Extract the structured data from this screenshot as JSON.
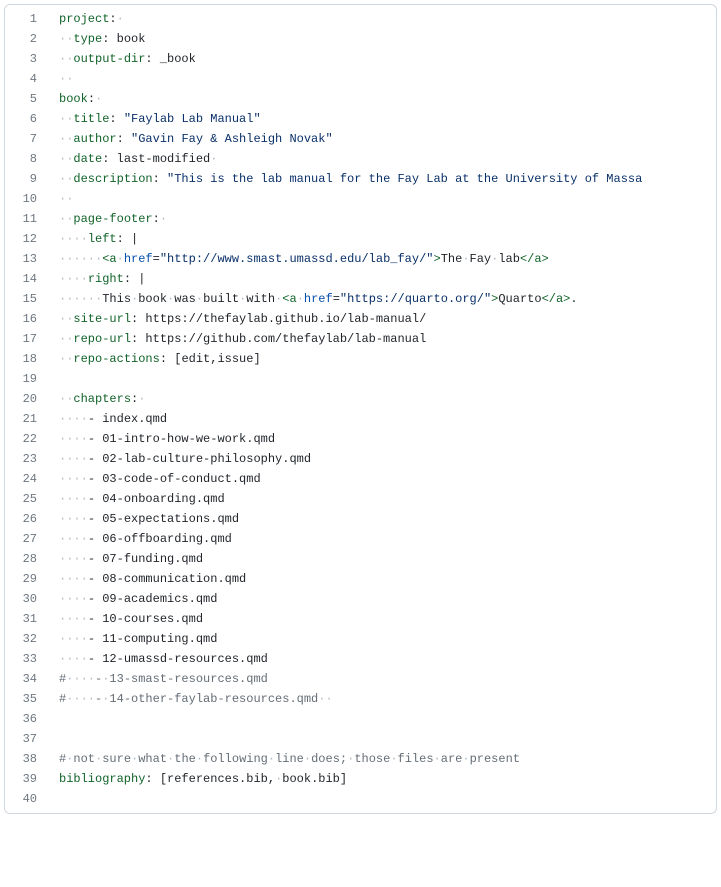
{
  "lines": [
    {
      "n": "1",
      "tokens": [
        {
          "c": "key",
          "t": "project"
        },
        {
          "c": "plain",
          "t": ":"
        },
        {
          "c": "ws",
          "t": "·"
        }
      ]
    },
    {
      "n": "2",
      "tokens": [
        {
          "c": "ws",
          "t": "··"
        },
        {
          "c": "key",
          "t": "type"
        },
        {
          "c": "plain",
          "t": ": "
        },
        {
          "c": "plain",
          "t": "book"
        }
      ]
    },
    {
      "n": "3",
      "tokens": [
        {
          "c": "ws",
          "t": "··"
        },
        {
          "c": "key",
          "t": "output-dir"
        },
        {
          "c": "plain",
          "t": ": "
        },
        {
          "c": "plain",
          "t": "_book"
        }
      ]
    },
    {
      "n": "4",
      "tokens": [
        {
          "c": "ws",
          "t": "··"
        }
      ]
    },
    {
      "n": "5",
      "tokens": [
        {
          "c": "key",
          "t": "book"
        },
        {
          "c": "plain",
          "t": ":"
        },
        {
          "c": "ws",
          "t": "·"
        }
      ]
    },
    {
      "n": "6",
      "tokens": [
        {
          "c": "ws",
          "t": "··"
        },
        {
          "c": "key",
          "t": "title"
        },
        {
          "c": "plain",
          "t": ": "
        },
        {
          "c": "str",
          "t": "\"Faylab Lab Manual\""
        }
      ]
    },
    {
      "n": "7",
      "tokens": [
        {
          "c": "ws",
          "t": "··"
        },
        {
          "c": "key",
          "t": "author"
        },
        {
          "c": "plain",
          "t": ": "
        },
        {
          "c": "str",
          "t": "\"Gavin Fay & Ashleigh Novak\""
        }
      ]
    },
    {
      "n": "8",
      "tokens": [
        {
          "c": "ws",
          "t": "··"
        },
        {
          "c": "key",
          "t": "date"
        },
        {
          "c": "plain",
          "t": ": "
        },
        {
          "c": "plain",
          "t": "last-modified"
        },
        {
          "c": "ws",
          "t": "·"
        }
      ]
    },
    {
      "n": "9",
      "tokens": [
        {
          "c": "ws",
          "t": "··"
        },
        {
          "c": "key",
          "t": "description"
        },
        {
          "c": "plain",
          "t": ": "
        },
        {
          "c": "str",
          "t": "\"This is the lab manual for the Fay Lab at the University of Massa"
        }
      ]
    },
    {
      "n": "10",
      "tokens": [
        {
          "c": "ws",
          "t": "··"
        }
      ]
    },
    {
      "n": "11",
      "tokens": [
        {
          "c": "ws",
          "t": "··"
        },
        {
          "c": "key",
          "t": "page-footer"
        },
        {
          "c": "plain",
          "t": ":"
        },
        {
          "c": "ws",
          "t": "·"
        }
      ]
    },
    {
      "n": "12",
      "tokens": [
        {
          "c": "ws",
          "t": "····"
        },
        {
          "c": "key",
          "t": "left"
        },
        {
          "c": "plain",
          "t": ": "
        },
        {
          "c": "plain",
          "t": "|"
        }
      ]
    },
    {
      "n": "13",
      "tokens": [
        {
          "c": "ws",
          "t": "······"
        },
        {
          "c": "tag",
          "t": "<a"
        },
        {
          "c": "ws",
          "t": "·"
        },
        {
          "c": "attr",
          "t": "href"
        },
        {
          "c": "plain",
          "t": "="
        },
        {
          "c": "str",
          "t": "\"http://www.smast.umassd.edu/lab_fay/\""
        },
        {
          "c": "tag",
          "t": ">"
        },
        {
          "c": "plain",
          "t": "The"
        },
        {
          "c": "ws",
          "t": "·"
        },
        {
          "c": "plain",
          "t": "Fay"
        },
        {
          "c": "ws",
          "t": "·"
        },
        {
          "c": "plain",
          "t": "lab"
        },
        {
          "c": "tag",
          "t": "</a>"
        }
      ]
    },
    {
      "n": "14",
      "tokens": [
        {
          "c": "ws",
          "t": "····"
        },
        {
          "c": "key",
          "t": "right"
        },
        {
          "c": "plain",
          "t": ": "
        },
        {
          "c": "plain",
          "t": "|"
        }
      ]
    },
    {
      "n": "15",
      "tokens": [
        {
          "c": "ws",
          "t": "······"
        },
        {
          "c": "plain",
          "t": "This"
        },
        {
          "c": "ws",
          "t": "·"
        },
        {
          "c": "plain",
          "t": "book"
        },
        {
          "c": "ws",
          "t": "·"
        },
        {
          "c": "plain",
          "t": "was"
        },
        {
          "c": "ws",
          "t": "·"
        },
        {
          "c": "plain",
          "t": "built"
        },
        {
          "c": "ws",
          "t": "·"
        },
        {
          "c": "plain",
          "t": "with"
        },
        {
          "c": "ws",
          "t": "·"
        },
        {
          "c": "tag",
          "t": "<a"
        },
        {
          "c": "ws",
          "t": "·"
        },
        {
          "c": "attr",
          "t": "href"
        },
        {
          "c": "plain",
          "t": "="
        },
        {
          "c": "str",
          "t": "\"https://quarto.org/\""
        },
        {
          "c": "tag",
          "t": ">"
        },
        {
          "c": "plain",
          "t": "Quarto"
        },
        {
          "c": "tag",
          "t": "</a>"
        },
        {
          "c": "plain",
          "t": "."
        }
      ]
    },
    {
      "n": "16",
      "tokens": [
        {
          "c": "ws",
          "t": "··"
        },
        {
          "c": "key",
          "t": "site-url"
        },
        {
          "c": "plain",
          "t": ": "
        },
        {
          "c": "plain",
          "t": "https://thefaylab.github.io/lab-manual/"
        }
      ]
    },
    {
      "n": "17",
      "tokens": [
        {
          "c": "ws",
          "t": "··"
        },
        {
          "c": "key",
          "t": "repo-url"
        },
        {
          "c": "plain",
          "t": ": "
        },
        {
          "c": "plain",
          "t": "https://github.com/thefaylab/lab-manual"
        }
      ]
    },
    {
      "n": "18",
      "tokens": [
        {
          "c": "ws",
          "t": "··"
        },
        {
          "c": "key",
          "t": "repo-actions"
        },
        {
          "c": "plain",
          "t": ": ["
        },
        {
          "c": "plain",
          "t": "edit"
        },
        {
          "c": "plain",
          "t": ","
        },
        {
          "c": "plain",
          "t": "issue"
        },
        {
          "c": "plain",
          "t": "]"
        }
      ]
    },
    {
      "n": "19",
      "tokens": []
    },
    {
      "n": "20",
      "tokens": [
        {
          "c": "ws",
          "t": "··"
        },
        {
          "c": "key",
          "t": "chapters"
        },
        {
          "c": "plain",
          "t": ":"
        },
        {
          "c": "ws",
          "t": "·"
        }
      ]
    },
    {
      "n": "21",
      "tokens": [
        {
          "c": "ws",
          "t": "····"
        },
        {
          "c": "plain",
          "t": "- "
        },
        {
          "c": "plain",
          "t": "index.qmd"
        }
      ]
    },
    {
      "n": "22",
      "tokens": [
        {
          "c": "ws",
          "t": "····"
        },
        {
          "c": "plain",
          "t": "- "
        },
        {
          "c": "plain",
          "t": "01-intro-how-we-work.qmd"
        }
      ]
    },
    {
      "n": "23",
      "tokens": [
        {
          "c": "ws",
          "t": "····"
        },
        {
          "c": "plain",
          "t": "- "
        },
        {
          "c": "plain",
          "t": "02-lab-culture-philosophy.qmd"
        }
      ]
    },
    {
      "n": "24",
      "tokens": [
        {
          "c": "ws",
          "t": "····"
        },
        {
          "c": "plain",
          "t": "- "
        },
        {
          "c": "plain",
          "t": "03-code-of-conduct.qmd"
        }
      ]
    },
    {
      "n": "25",
      "tokens": [
        {
          "c": "ws",
          "t": "····"
        },
        {
          "c": "plain",
          "t": "- "
        },
        {
          "c": "plain",
          "t": "04-onboarding.qmd"
        }
      ]
    },
    {
      "n": "26",
      "tokens": [
        {
          "c": "ws",
          "t": "····"
        },
        {
          "c": "plain",
          "t": "- "
        },
        {
          "c": "plain",
          "t": "05-expectations.qmd"
        }
      ]
    },
    {
      "n": "27",
      "tokens": [
        {
          "c": "ws",
          "t": "····"
        },
        {
          "c": "plain",
          "t": "- "
        },
        {
          "c": "plain",
          "t": "06-offboarding.qmd"
        }
      ]
    },
    {
      "n": "28",
      "tokens": [
        {
          "c": "ws",
          "t": "····"
        },
        {
          "c": "plain",
          "t": "- "
        },
        {
          "c": "plain",
          "t": "07-funding.qmd"
        }
      ]
    },
    {
      "n": "29",
      "tokens": [
        {
          "c": "ws",
          "t": "····"
        },
        {
          "c": "plain",
          "t": "- "
        },
        {
          "c": "plain",
          "t": "08-communication.qmd"
        }
      ]
    },
    {
      "n": "30",
      "tokens": [
        {
          "c": "ws",
          "t": "····"
        },
        {
          "c": "plain",
          "t": "- "
        },
        {
          "c": "plain",
          "t": "09-academics.qmd"
        }
      ]
    },
    {
      "n": "31",
      "tokens": [
        {
          "c": "ws",
          "t": "····"
        },
        {
          "c": "plain",
          "t": "- "
        },
        {
          "c": "plain",
          "t": "10-courses.qmd"
        }
      ]
    },
    {
      "n": "32",
      "tokens": [
        {
          "c": "ws",
          "t": "····"
        },
        {
          "c": "plain",
          "t": "- "
        },
        {
          "c": "plain",
          "t": "11-computing.qmd"
        }
      ]
    },
    {
      "n": "33",
      "tokens": [
        {
          "c": "ws",
          "t": "····"
        },
        {
          "c": "plain",
          "t": "- "
        },
        {
          "c": "plain",
          "t": "12-umassd-resources.qmd"
        }
      ]
    },
    {
      "n": "34",
      "tokens": [
        {
          "c": "cmt",
          "t": "#"
        },
        {
          "c": "ws",
          "t": "····"
        },
        {
          "c": "cmt",
          "t": "-"
        },
        {
          "c": "ws",
          "t": "·"
        },
        {
          "c": "cmt",
          "t": "13-smast-resources.qmd"
        }
      ]
    },
    {
      "n": "35",
      "tokens": [
        {
          "c": "cmt",
          "t": "#"
        },
        {
          "c": "ws",
          "t": "····"
        },
        {
          "c": "cmt",
          "t": "-"
        },
        {
          "c": "ws",
          "t": "·"
        },
        {
          "c": "cmt",
          "t": "14-other-faylab-resources.qmd"
        },
        {
          "c": "ws",
          "t": "··"
        }
      ]
    },
    {
      "n": "36",
      "tokens": []
    },
    {
      "n": "37",
      "tokens": []
    },
    {
      "n": "38",
      "tokens": [
        {
          "c": "cmt",
          "t": "#"
        },
        {
          "c": "ws",
          "t": "·"
        },
        {
          "c": "cmt",
          "t": "not"
        },
        {
          "c": "ws",
          "t": "·"
        },
        {
          "c": "cmt",
          "t": "sure"
        },
        {
          "c": "ws",
          "t": "·"
        },
        {
          "c": "cmt",
          "t": "what"
        },
        {
          "c": "ws",
          "t": "·"
        },
        {
          "c": "cmt",
          "t": "the"
        },
        {
          "c": "ws",
          "t": "·"
        },
        {
          "c": "cmt",
          "t": "following"
        },
        {
          "c": "ws",
          "t": "·"
        },
        {
          "c": "cmt",
          "t": "line"
        },
        {
          "c": "ws",
          "t": "·"
        },
        {
          "c": "cmt",
          "t": "does;"
        },
        {
          "c": "ws",
          "t": "·"
        },
        {
          "c": "cmt",
          "t": "those"
        },
        {
          "c": "ws",
          "t": "·"
        },
        {
          "c": "cmt",
          "t": "files"
        },
        {
          "c": "ws",
          "t": "·"
        },
        {
          "c": "cmt",
          "t": "are"
        },
        {
          "c": "ws",
          "t": "·"
        },
        {
          "c": "cmt",
          "t": "present"
        }
      ]
    },
    {
      "n": "39",
      "tokens": [
        {
          "c": "key",
          "t": "bibliography"
        },
        {
          "c": "plain",
          "t": ": ["
        },
        {
          "c": "plain",
          "t": "references.bib"
        },
        {
          "c": "plain",
          "t": ","
        },
        {
          "c": "ws",
          "t": "·"
        },
        {
          "c": "plain",
          "t": "book.bib"
        },
        {
          "c": "plain",
          "t": "]"
        }
      ]
    },
    {
      "n": "40",
      "tokens": []
    }
  ]
}
